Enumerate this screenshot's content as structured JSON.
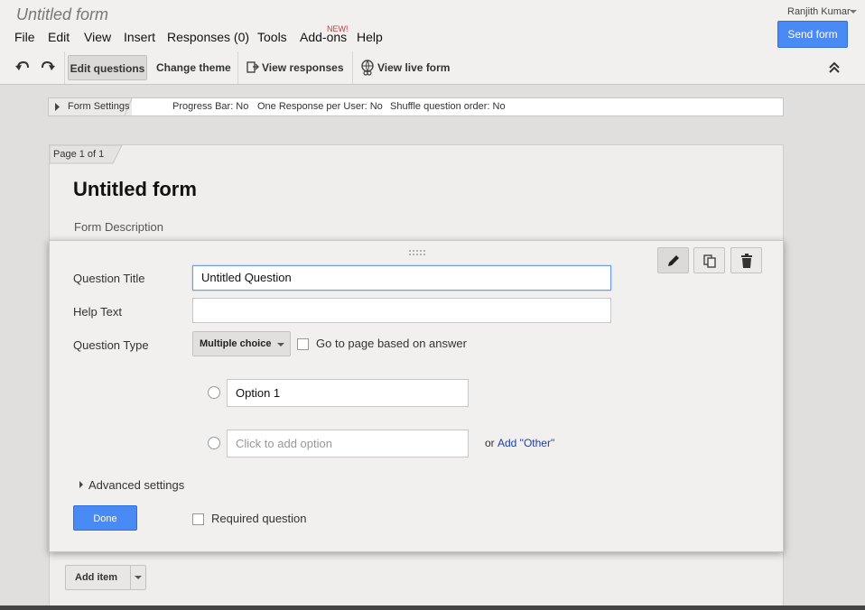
{
  "header": {
    "doc_title": "Untitled form",
    "menu": [
      "File",
      "Edit",
      "View",
      "Insert",
      "Responses (0)",
      "Tools",
      "Add-ons",
      "Help"
    ],
    "new_badge": "NEW!",
    "user_name": "Ranjith Kumar",
    "send_form_label": "Send form"
  },
  "toolbar": {
    "edit_questions": "Edit questions",
    "change_theme": "Change theme",
    "view_responses": "View responses",
    "view_live_form": "View live form"
  },
  "settings": {
    "tab_label": "Form Settings",
    "progress_bar": "Progress Bar: No",
    "one_response": "One Response per User: No",
    "shuffle": "Shuffle question order: No"
  },
  "page": {
    "tab_label": "Page 1 of 1",
    "form_title": "Untitled form",
    "form_description": "Form Description"
  },
  "question": {
    "title_label": "Question Title",
    "title_value": "Untitled Question",
    "help_label": "Help Text",
    "help_value": "",
    "type_label": "Question Type",
    "type_value": "Multiple choice",
    "go_to_page_label": "Go to page based on answer",
    "option1_value": "Option 1",
    "add_option_placeholder": "Click to add option",
    "or_text": "or",
    "add_other_link": "Add \"Other\"",
    "advanced_settings": "Advanced settings",
    "done_label": "Done",
    "required_label": "Required question"
  },
  "add_item_label": "Add item",
  "colors": {
    "accent_blue": "#4a8af4",
    "link_blue": "#1f3fa0",
    "new_badge_red": "#dd3333"
  }
}
